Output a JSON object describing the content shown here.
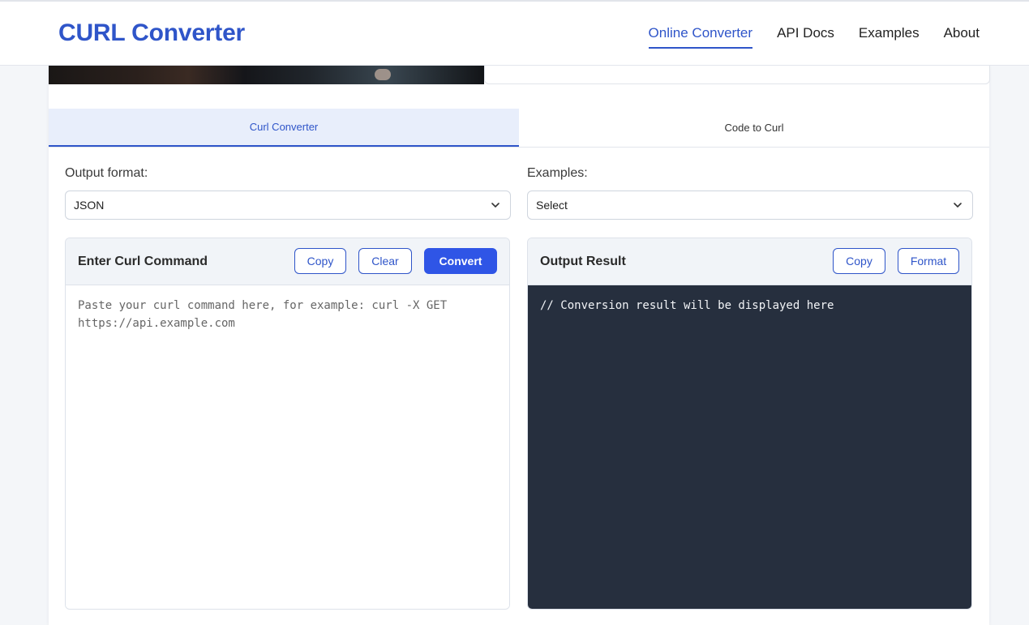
{
  "header": {
    "brand": "CURL Converter",
    "nav": [
      "Online Converter",
      "API Docs",
      "Examples",
      "About"
    ],
    "active_nav": "Online Converter"
  },
  "tabs": [
    "Curl Converter",
    "Code to Curl"
  ],
  "active_tab": "Curl Converter",
  "output_format": {
    "label": "Output format:",
    "value": "JSON"
  },
  "examples": {
    "label": "Examples:",
    "value": "Select"
  },
  "input_panel": {
    "title": "Enter Curl Command",
    "copy": "Copy",
    "clear": "Clear",
    "convert": "Convert",
    "placeholder": "Paste your curl command here, for example: curl -X GET https://api.example.com"
  },
  "output_panel": {
    "title": "Output Result",
    "copy": "Copy",
    "format": "Format",
    "content": "// Conversion result will be displayed here"
  },
  "colors": {
    "accent": "#2f55c9",
    "primary_button": "#2f55e6",
    "output_bg": "#262f3e",
    "active_tab_bg": "#e8eefb"
  }
}
